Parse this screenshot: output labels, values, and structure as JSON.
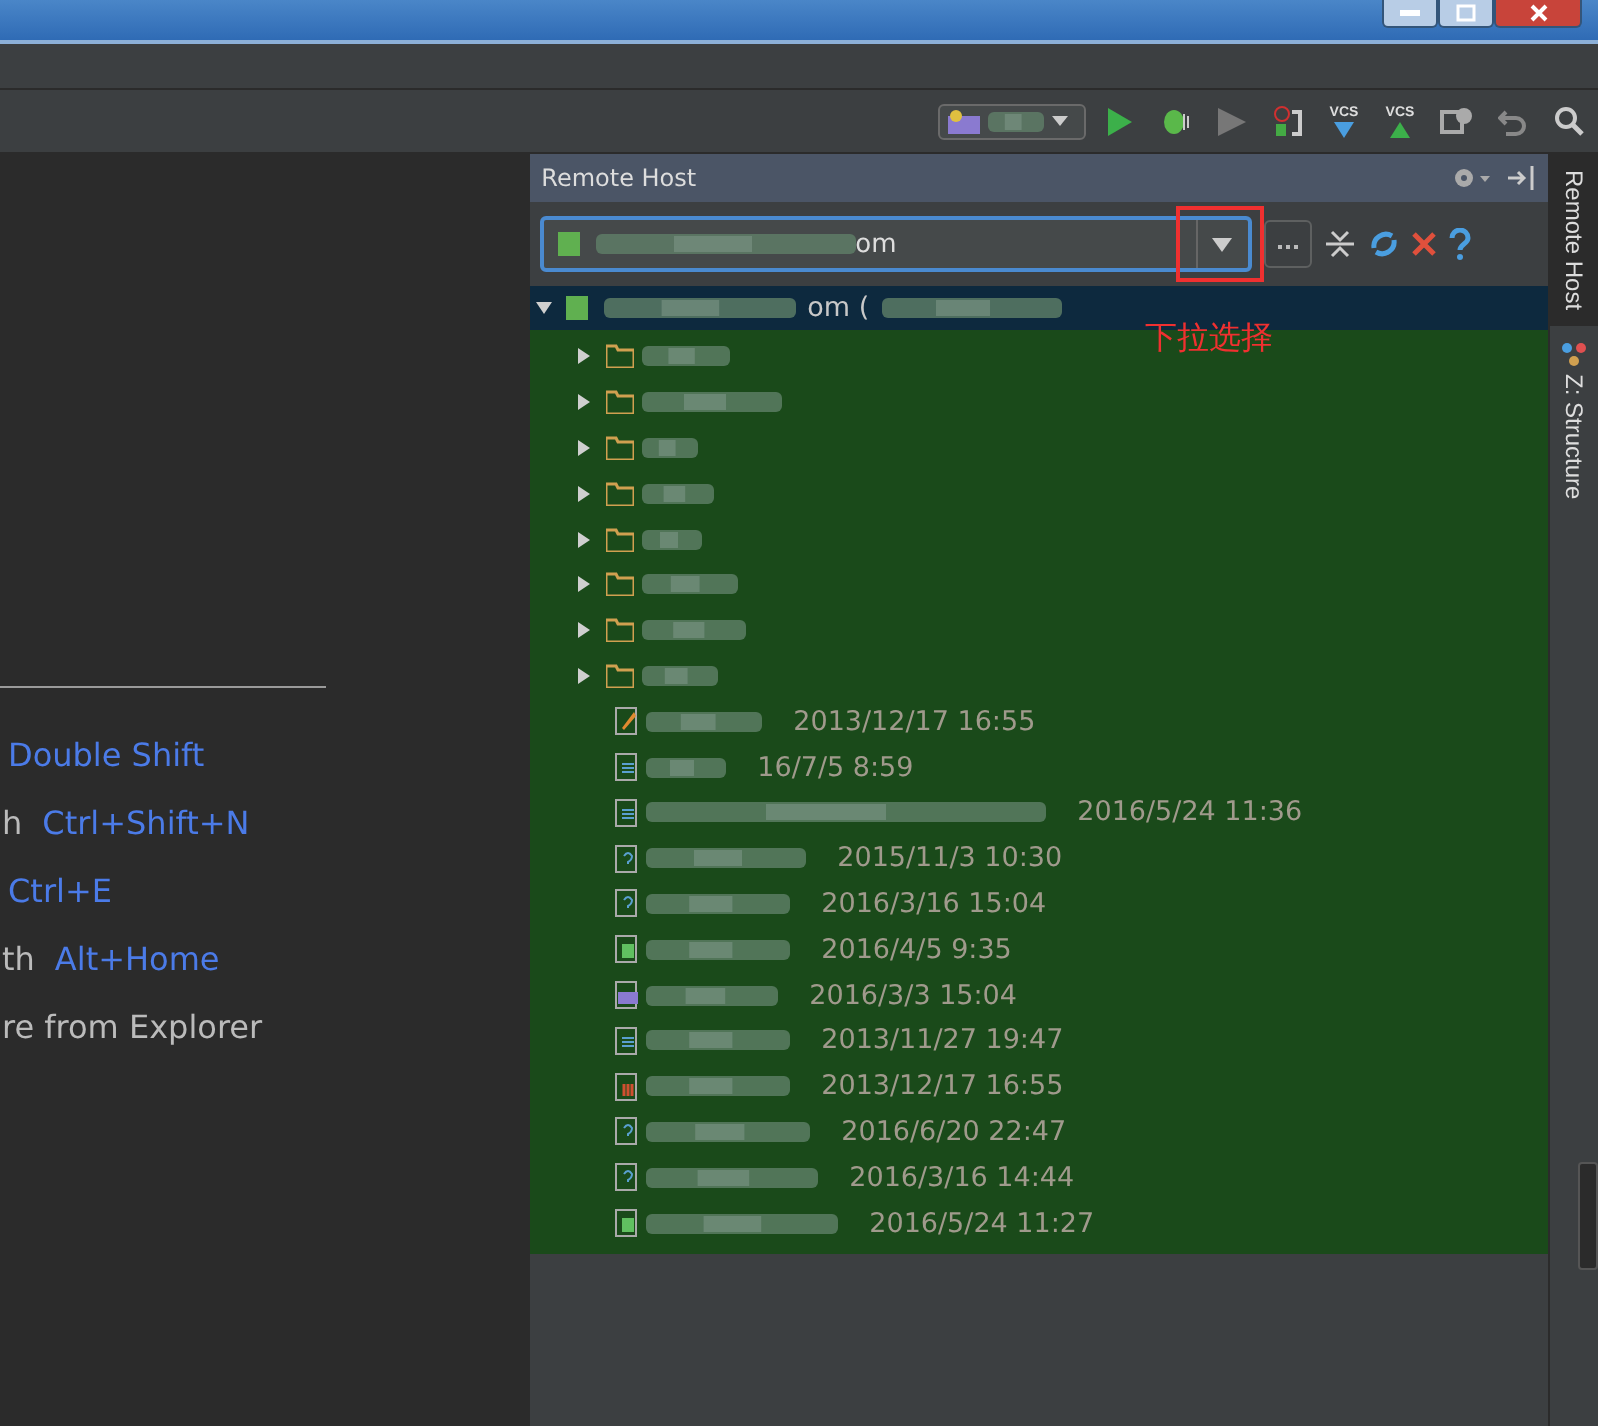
{
  "toolbar": {
    "vcs_labels": [
      "VCS",
      "VCS"
    ]
  },
  "left_panel": {
    "shortcuts": [
      {
        "key": "Double Shift"
      },
      {
        "label": "h",
        "key": "Ctrl+Shift+N"
      },
      {
        "key": "Ctrl+E"
      },
      {
        "label": "th",
        "key": "Alt+Home"
      },
      {
        "label": "re from Explorer"
      }
    ]
  },
  "remote_host": {
    "title": "Remote Host",
    "server_value": "om",
    "root": {
      "label": "om (",
      "expanded": true
    },
    "folders": [
      {
        "expanded": false
      },
      {
        "expanded": false
      },
      {
        "expanded": false
      },
      {
        "expanded": false
      },
      {
        "expanded": false
      },
      {
        "expanded": false
      },
      {
        "expanded": false
      },
      {
        "expanded": false
      }
    ],
    "files": [
      {
        "kind": "image",
        "date": "2013/12/17 16:55"
      },
      {
        "kind": "text",
        "date": "16/7/5 8:59"
      },
      {
        "kind": "text",
        "date": "2016/5/24 11:36"
      },
      {
        "kind": "unknown",
        "date": "2015/11/3 10:30"
      },
      {
        "kind": "unknown",
        "date": "2016/3/16 15:04"
      },
      {
        "kind": "html",
        "date": "2016/4/5 9:35"
      },
      {
        "kind": "php",
        "date": "2016/3/3 15:04"
      },
      {
        "kind": "text",
        "date": "2013/11/27 19:47"
      },
      {
        "kind": "archive",
        "date": "2013/12/17 16:55"
      },
      {
        "kind": "unknown",
        "date": "2016/6/20 22:47"
      },
      {
        "kind": "unknown",
        "date": "2016/3/16 14:44"
      },
      {
        "kind": "html",
        "date": "2016/5/24 11:27"
      }
    ]
  },
  "annotation": {
    "text": "下拉选择"
  },
  "side_tabs": [
    {
      "label": "Remote Host",
      "selected": true
    },
    {
      "label": "Z: Structure",
      "selected": false
    }
  ]
}
